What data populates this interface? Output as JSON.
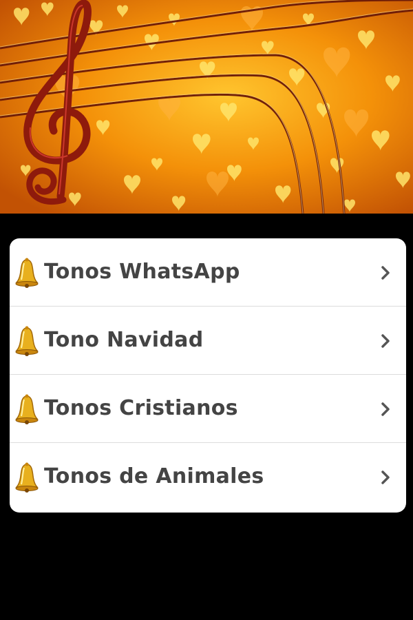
{
  "banner": {
    "icon": "treble-clef-hearts-banner",
    "colors": {
      "orange": "#f59a0c",
      "gold": "#ffe46a",
      "clef": "#8e1a0c"
    }
  },
  "menu": {
    "items": [
      {
        "label": "Tonos WhatsApp",
        "icon": "bell-icon",
        "chevron": "chevron-right-icon"
      },
      {
        "label": "Tono Navidad",
        "icon": "bell-icon",
        "chevron": "chevron-right-icon"
      },
      {
        "label": "Tonos Cristianos",
        "icon": "bell-icon",
        "chevron": "chevron-right-icon"
      },
      {
        "label": "Tonos de Animales",
        "icon": "bell-icon",
        "chevron": "chevron-right-icon"
      }
    ]
  }
}
